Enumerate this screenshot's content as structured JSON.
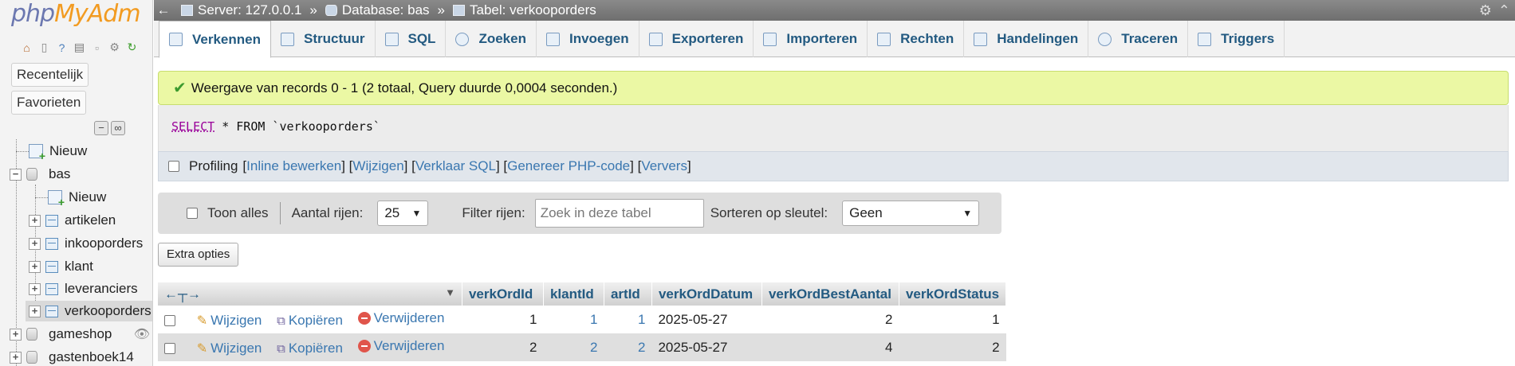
{
  "nav": {
    "logo_php": "php",
    "logo_rest": "MyAdm",
    "recent_label": "Recentelijk",
    "favorites_label": "Favorieten",
    "tree": [
      {
        "label": "Nieuw",
        "type": "new"
      },
      {
        "label": "bas",
        "type": "db",
        "expanded": true
      },
      {
        "label": "Nieuw",
        "type": "new-table"
      },
      {
        "label": "artikelen",
        "type": "table"
      },
      {
        "label": "inkooporders",
        "type": "table"
      },
      {
        "label": "klant",
        "type": "table"
      },
      {
        "label": "leveranciers",
        "type": "table"
      },
      {
        "label": "verkooporders",
        "type": "table",
        "selected": true
      },
      {
        "label": "gameshop",
        "type": "db"
      },
      {
        "label": "gastenboek14",
        "type": "db"
      }
    ]
  },
  "topbar": {
    "server": "Server: 127.0.0.1",
    "database": "Database: bas",
    "table": "Tabel: verkooporders",
    "separator": "»"
  },
  "tabs": [
    {
      "label": "Verkennen",
      "active": true
    },
    {
      "label": "Structuur"
    },
    {
      "label": "SQL"
    },
    {
      "label": "Zoeken"
    },
    {
      "label": "Invoegen"
    },
    {
      "label": "Exporteren"
    },
    {
      "label": "Importeren"
    },
    {
      "label": "Rechten"
    },
    {
      "label": "Handelingen"
    },
    {
      "label": "Traceren"
    },
    {
      "label": "Triggers"
    }
  ],
  "message": "Weergave van records 0 - 1 (2 totaal, Query duurde 0,0004 seconden.)",
  "sql": {
    "select": "SELECT",
    "rest": " * FROM `verkooporders`"
  },
  "profiling": {
    "label": "Profiling",
    "links": [
      "Inline bewerken",
      "Wijzigen",
      "Verklaar SQL",
      "Genereer PHP-code",
      "Ververs"
    ]
  },
  "filter": {
    "show_all": "Toon alles",
    "rows_label": "Aantal rijen:",
    "rows_value": "25",
    "filter_label": "Filter rijen:",
    "filter_placeholder": "Zoek in deze tabel",
    "sort_label": "Sorteren op sleutel:",
    "sort_value": "Geen"
  },
  "extra_options": "Extra opties",
  "table": {
    "columns": [
      "verkOrdId",
      "klantId",
      "artId",
      "verkOrdDatum",
      "verkOrdBestAantal",
      "verkOrdStatus"
    ],
    "actions": {
      "edit": "Wijzigen",
      "copy": "Kopiëren",
      "delete": "Verwijderen"
    },
    "rows": [
      [
        "1",
        "1",
        "1",
        "2025-05-27",
        "2",
        "1"
      ],
      [
        "2",
        "2",
        "2",
        "2025-05-27",
        "4",
        "2"
      ]
    ]
  }
}
